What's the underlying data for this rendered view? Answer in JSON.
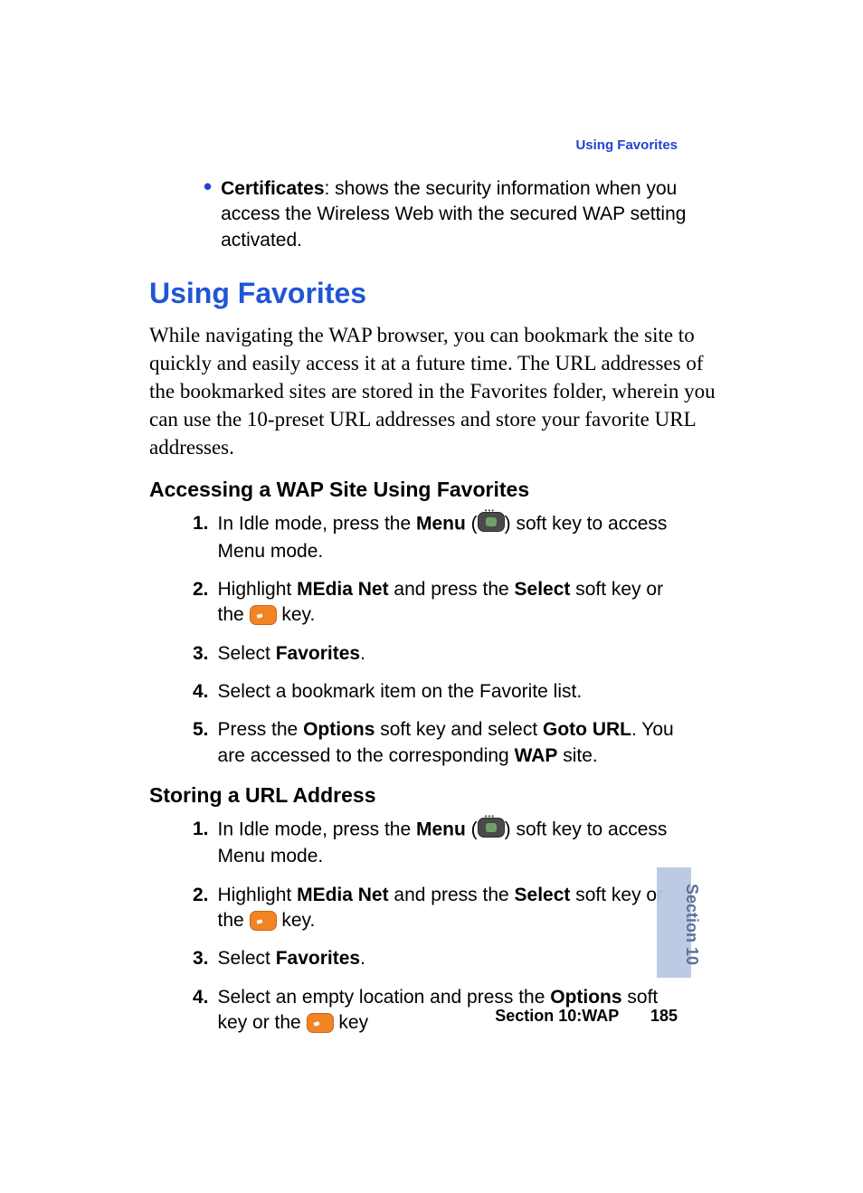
{
  "running_header": "Using Favorites",
  "bullet": {
    "term": "Certificates",
    "desc": ": shows the security information when you access the Wireless Web with the secured WAP setting activated."
  },
  "h1": "Using Favorites",
  "intro": "While navigating the WAP browser, you can bookmark the site to quickly and easily access it at a future time. The URL addresses of the bookmarked sites are stored in the Favorites folder, wherein you can use the 10-preset URL addresses and store your favorite URL addresses.",
  "section_a": {
    "title": "Accessing a WAP Site Using Favorites",
    "steps": [
      {
        "n": "1.",
        "pre1": "In Idle mode, press the ",
        "b1": "Menu",
        "mid1": " (",
        "icon1": "nav",
        "mid2": ") soft key to access Menu mode."
      },
      {
        "n": "2.",
        "pre1": "Highlight ",
        "b1": "MEdia Net",
        "mid1": " and press the ",
        "b2": "Select",
        "mid2": " soft key or the ",
        "icon1": "orange",
        "tail": " key."
      },
      {
        "n": "3.",
        "pre1": "Select ",
        "b1": "Favorites",
        "tail": "."
      },
      {
        "n": "4.",
        "plain": "Select a bookmark item on the Favorite list."
      },
      {
        "n": "5.",
        "pre1": "Press the ",
        "b1": "Options",
        "mid1": " soft key and select ",
        "b2": "Goto URL",
        "mid2": ". You are accessed to the corresponding ",
        "b3": "WAP",
        "tail": " site."
      }
    ]
  },
  "section_b": {
    "title": "Storing a URL Address",
    "steps": [
      {
        "n": "1.",
        "pre1": "In Idle mode, press the ",
        "b1": "Menu",
        "mid1": " (",
        "icon1": "nav",
        "mid2": ") soft key to access Menu mode."
      },
      {
        "n": "2.",
        "pre1": "Highlight ",
        "b1": "MEdia Net",
        "mid1": " and press the ",
        "b2": "Select",
        "mid2": " soft key or the ",
        "icon1": "orange",
        "tail": " key."
      },
      {
        "n": "3.",
        "pre1": "Select ",
        "b1": "Favorites",
        "tail": "."
      },
      {
        "n": "4.",
        "pre1": "Select an empty location and press the ",
        "b1": "Options",
        "mid1": " soft key or the ",
        "icon1": "orange",
        "tail": " key"
      }
    ]
  },
  "footer": {
    "section": "Section 10:WAP",
    "page": "185"
  },
  "side_tab": "Section 10"
}
